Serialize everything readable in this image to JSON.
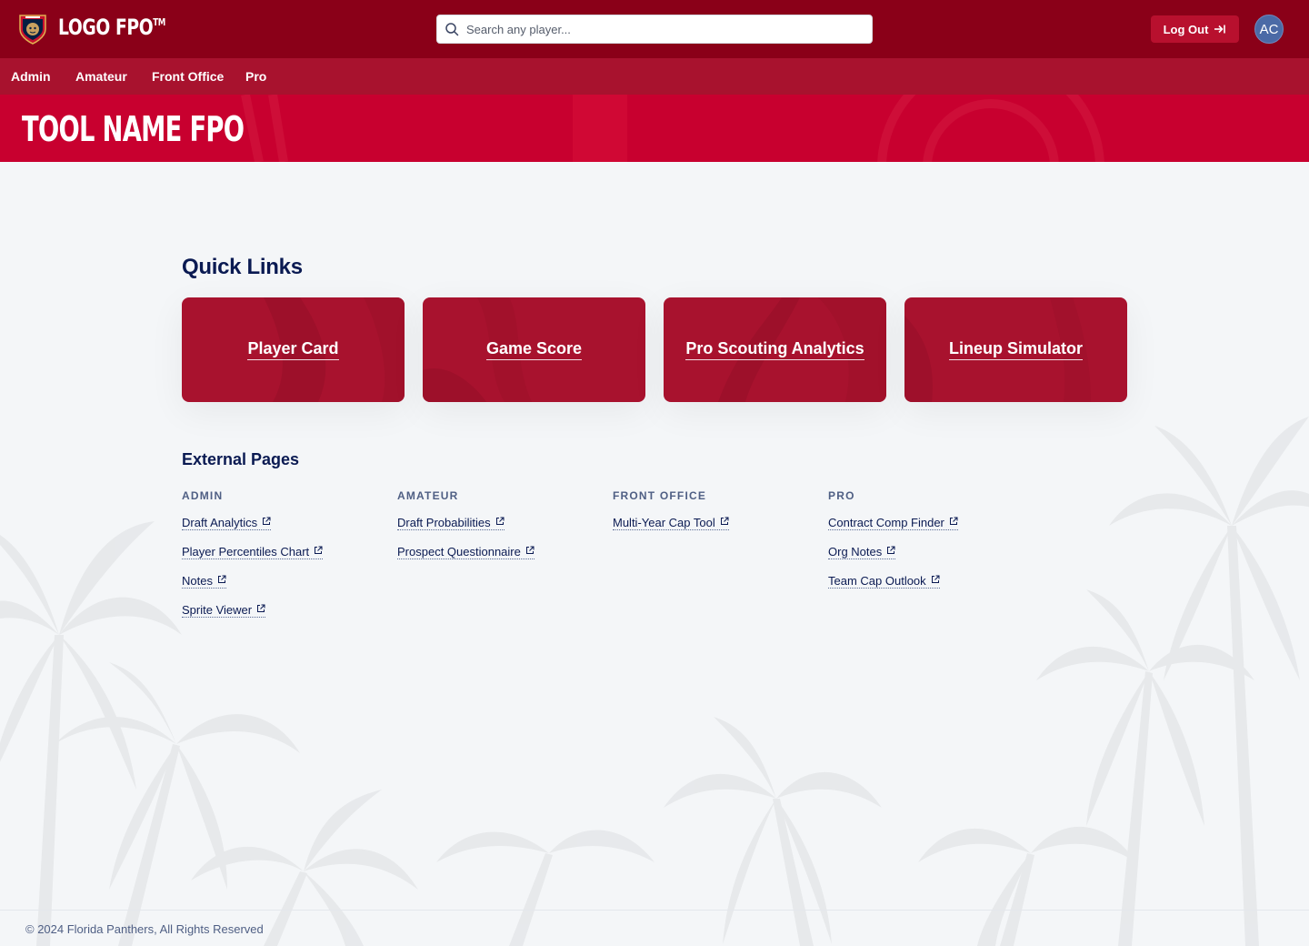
{
  "header": {
    "logo_text": "LOGO FPO",
    "logo_trademark": "TM",
    "search_placeholder": "Search any player...",
    "logout_label": "Log Out",
    "avatar_initials": "AC"
  },
  "nav": {
    "items": [
      {
        "label": "Admin"
      },
      {
        "label": "Amateur"
      },
      {
        "label": "Front Office"
      },
      {
        "label": "Pro"
      }
    ]
  },
  "hero": {
    "title": "TOOL NAME FPO"
  },
  "quick_links": {
    "title": "Quick Links",
    "cards": [
      {
        "label": "Player Card"
      },
      {
        "label": "Game Score"
      },
      {
        "label": "Pro Scouting Analytics"
      },
      {
        "label": "Lineup Simulator"
      }
    ]
  },
  "external_pages": {
    "title": "External Pages",
    "columns": [
      {
        "heading": "ADMIN",
        "links": [
          "Draft Analytics",
          "Player Percentiles Chart",
          "Notes",
          "Sprite Viewer"
        ]
      },
      {
        "heading": "AMATEUR",
        "links": [
          "Draft Probabilities",
          "Prospect Questionnaire"
        ]
      },
      {
        "heading": "FRONT OFFICE",
        "links": [
          "Multi-Year Cap Tool"
        ]
      },
      {
        "heading": "PRO",
        "links": [
          "Contract Comp Finder",
          "Org Notes",
          "Team Cap Outlook"
        ]
      }
    ]
  },
  "footer": {
    "copyright": "© 2024 Florida Panthers, All Rights Reserved"
  },
  "colors": {
    "topbar": "#8a0018",
    "navbar": "#a8122e",
    "hero": "#c8002f",
    "card": "#a8122e",
    "text_navy": "#0a1a52"
  }
}
